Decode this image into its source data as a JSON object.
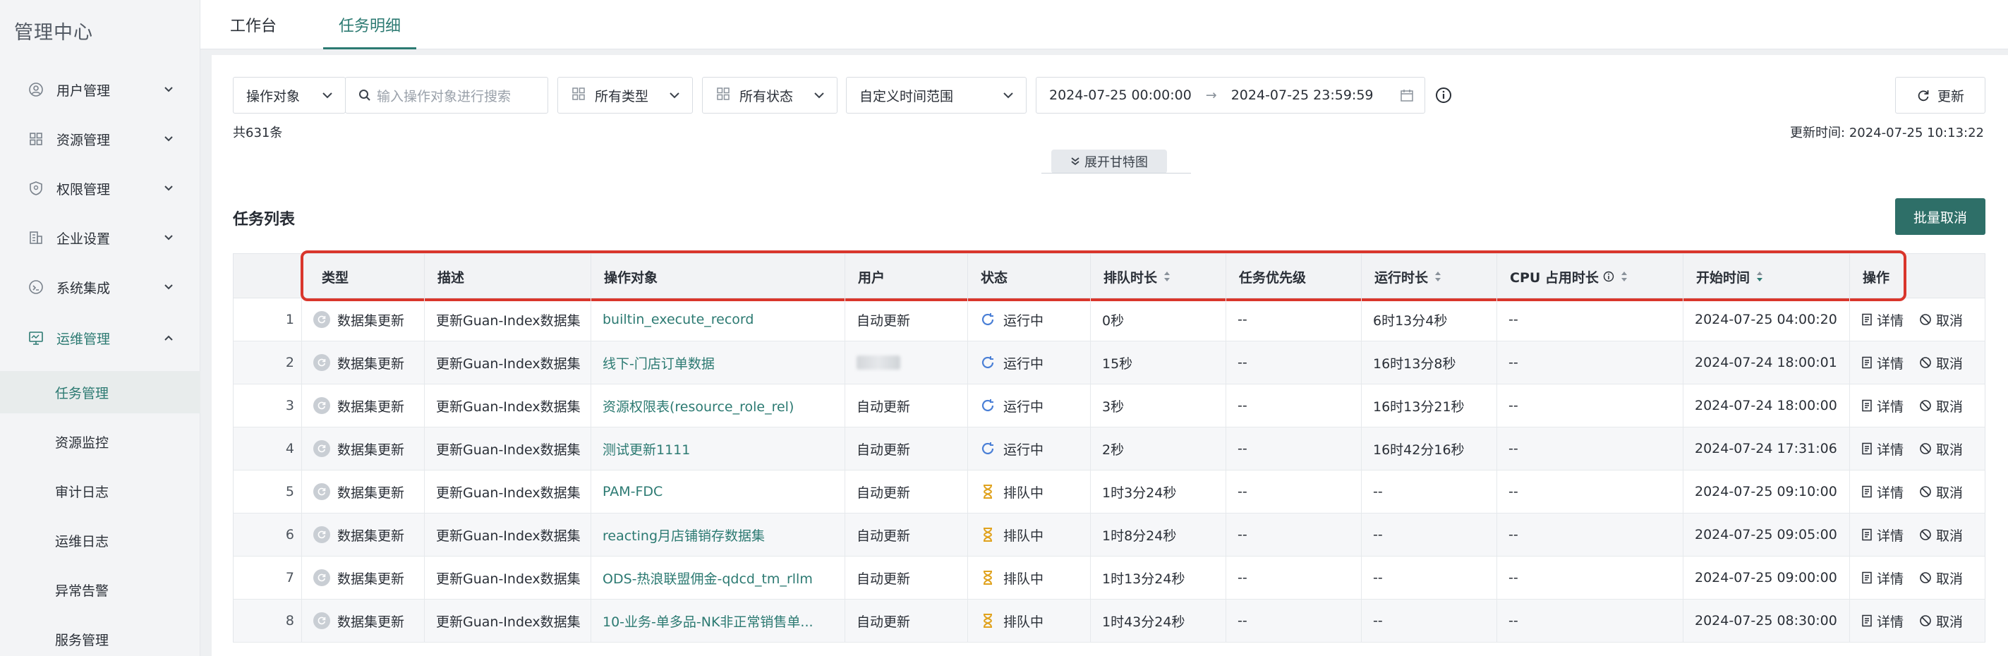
{
  "sidebar": {
    "brand": "管理中心",
    "groups": [
      {
        "label": "用户管理",
        "icon": "user-icon"
      },
      {
        "label": "资源管理",
        "icon": "grid-icon"
      },
      {
        "label": "权限管理",
        "icon": "shield-icon"
      },
      {
        "label": "企业设置",
        "icon": "building-icon"
      },
      {
        "label": "系统集成",
        "icon": "integration-icon"
      },
      {
        "label": "运维管理",
        "icon": "monitor-icon"
      }
    ],
    "sub_items": [
      {
        "label": "任务管理"
      },
      {
        "label": "资源监控"
      },
      {
        "label": "审计日志"
      },
      {
        "label": "运维日志"
      },
      {
        "label": "异常告警"
      },
      {
        "label": "服务管理"
      }
    ]
  },
  "tabs": [
    {
      "label": "工作台"
    },
    {
      "label": "任务明细"
    }
  ],
  "filters": {
    "object_select": "操作对象",
    "search_placeholder": "输入操作对象进行搜索",
    "type_select": "所有类型",
    "status_select": "所有状态",
    "range_select": "自定义时间范围",
    "start_time": "2024-07-25 00:00:00",
    "arrow": "→",
    "end_time": "2024-07-25 23:59:59",
    "refresh": "更新"
  },
  "meta": {
    "total": "共631条",
    "updated": "更新时间: 2024-07-25 10:13:22",
    "gantt": "展开甘特图"
  },
  "section": {
    "title": "任务列表",
    "batch_cancel": "批量取消"
  },
  "table": {
    "headers": [
      "类型",
      "描述",
      "操作对象",
      "用户",
      "状态",
      "排队时长",
      "任务优先级",
      "运行时长",
      "CPU 占用时长",
      "开始时间",
      "操作"
    ],
    "detail_label": "详情",
    "cancel_label": "取消",
    "rows": [
      {
        "idx": "1",
        "type": "数据集更新",
        "desc": "更新Guan-Index数据集",
        "target": "builtin_execute_record",
        "user": "自动更新",
        "status": "运行中",
        "status_kind": "running",
        "queue": "0秒",
        "priority": "--",
        "run": "6时13分4秒",
        "cpu": "--",
        "start": "2024-07-25 04:00:20"
      },
      {
        "idx": "2",
        "type": "数据集更新",
        "desc": "更新Guan-Index数据集",
        "target": "线下-门店订单数据",
        "user": "",
        "status": "运行中",
        "status_kind": "running",
        "queue": "15秒",
        "priority": "--",
        "run": "16时13分8秒",
        "cpu": "--",
        "start": "2024-07-24 18:00:01"
      },
      {
        "idx": "3",
        "type": "数据集更新",
        "desc": "更新Guan-Index数据集",
        "target": "资源权限表(resource_role_rel)",
        "user": "自动更新",
        "status": "运行中",
        "status_kind": "running",
        "queue": "3秒",
        "priority": "--",
        "run": "16时13分21秒",
        "cpu": "--",
        "start": "2024-07-24 18:00:00"
      },
      {
        "idx": "4",
        "type": "数据集更新",
        "desc": "更新Guan-Index数据集",
        "target": "测试更新1111",
        "user": "自动更新",
        "status": "运行中",
        "status_kind": "running",
        "queue": "2秒",
        "priority": "--",
        "run": "16时42分16秒",
        "cpu": "--",
        "start": "2024-07-24 17:31:06"
      },
      {
        "idx": "5",
        "type": "数据集更新",
        "desc": "更新Guan-Index数据集",
        "target": "PAM-FDC",
        "user": "自动更新",
        "status": "排队中",
        "status_kind": "queued",
        "queue": "1时3分24秒",
        "priority": "--",
        "run": "--",
        "cpu": "--",
        "start": "2024-07-25 09:10:00"
      },
      {
        "idx": "6",
        "type": "数据集更新",
        "desc": "更新Guan-Index数据集",
        "target": "reacting月店铺销存数据集",
        "user": "自动更新",
        "status": "排队中",
        "status_kind": "queued",
        "queue": "1时8分24秒",
        "priority": "--",
        "run": "--",
        "cpu": "--",
        "start": "2024-07-25 09:05:00"
      },
      {
        "idx": "7",
        "type": "数据集更新",
        "desc": "更新Guan-Index数据集",
        "target": "ODS-热浪联盟佣金-qdcd_tm_rllm",
        "user": "自动更新",
        "status": "排队中",
        "status_kind": "queued",
        "queue": "1时13分24秒",
        "priority": "--",
        "run": "--",
        "cpu": "--",
        "start": "2024-07-25 09:00:00"
      },
      {
        "idx": "8",
        "type": "数据集更新",
        "desc": "更新Guan-Index数据集",
        "target": "10-业务-单多品-NK非正常销售单...",
        "user": "自动更新",
        "status": "排队中",
        "status_kind": "queued",
        "queue": "1时43分24秒",
        "priority": "--",
        "run": "--",
        "cpu": "--",
        "start": "2024-07-25 08:30:00"
      }
    ]
  },
  "colors": {
    "accent": "#2c7a72",
    "primary_button": "#2e6f68",
    "highlight_box": "#d9362c",
    "queued_icon": "#e0a21d"
  }
}
